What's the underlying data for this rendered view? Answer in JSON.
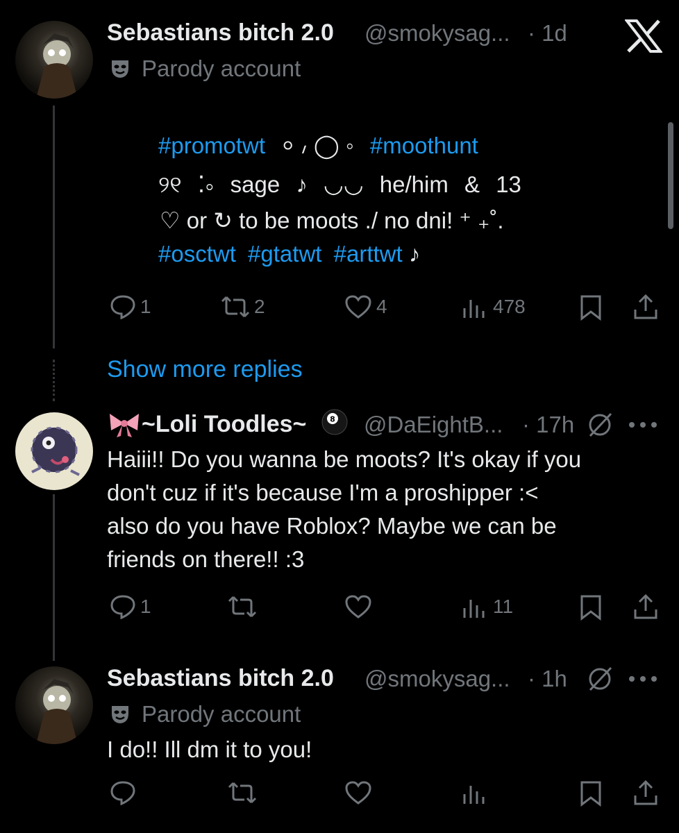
{
  "tweets": [
    {
      "name": "Sebastians bitch 2.0",
      "handle": "@smokysag...",
      "time": "· 1d",
      "label": "Parody account",
      "lines": [
        [
          "#promotwt",
          " ⸰ ៸ ◯ ◦ ",
          "#moothunt"
        ],
        [
          "୨୧ ⁚⸰ sage ♪ ◡◡ he/him & 13"
        ],
        [
          "♡ or ↻ to be moots ./ no dni! ⁺ ₊˚."
        ],
        [
          "#osctwt",
          "#gtatwt",
          "#arttwt",
          " ♪"
        ]
      ],
      "replies": "1",
      "reposts": "2",
      "likes": "4",
      "views": "478"
    },
    {
      "show_more": "Show more replies"
    },
    {
      "name": "~Loli Toodles~",
      "handle": "@DaEightB...",
      "time": "· 17h",
      "body": [
        "Haiii!! Do you wanna be moots? It's okay if you",
        "don't cuz if it's because I'm a proshipper :<",
        "also do you have Roblox? Maybe we can be",
        "friends on there!! :3"
      ],
      "replies": "1",
      "reposts": "",
      "likes": "",
      "views": "11"
    },
    {
      "name": "Sebastians bitch 2.0",
      "handle": "@smokysag...",
      "time": "· 1h",
      "label": "Parody account",
      "body": [
        "I do!! Ill dm it to you!"
      ]
    }
  ],
  "colors": {
    "link": "#1d9bf0",
    "muted": "#71767b",
    "text": "#e7e9ea"
  },
  "icons": [
    "x-logo-icon",
    "parody-mask-icon",
    "reply-icon",
    "repost-icon",
    "like-icon",
    "views-icon",
    "bookmark-icon",
    "share-icon",
    "bow-icon",
    "eight-ball-icon",
    "mute-icon",
    "more-icon"
  ]
}
